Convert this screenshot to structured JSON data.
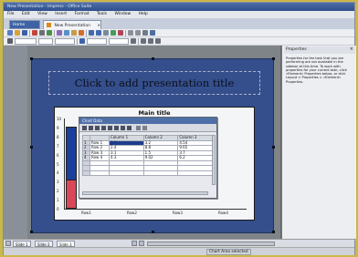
{
  "window": {
    "title": "New Presentation - Impress - Office Suite"
  },
  "menu": [
    "File",
    "Edit",
    "View",
    "Insert",
    "Format",
    "Tools",
    "Window",
    "Help"
  ],
  "tabs": {
    "home_label": "Home",
    "doc_label": "New Presentation",
    "doc_close": "×"
  },
  "slide": {
    "title_placeholder": "Click to add presentation title"
  },
  "chart": {
    "title": "Main title",
    "y_ticks": [
      "10",
      "9",
      "8",
      "7",
      "6",
      "5",
      "4",
      "3",
      "2",
      "1",
      "0"
    ]
  },
  "datasheet": {
    "title": "Chart Data",
    "columns": [
      "",
      "",
      "Column 1",
      "Column 2",
      "Column 3"
    ],
    "rows": [
      [
        "1",
        "Row 1",
        "9.1",
        "3.2",
        "4.54"
      ],
      [
        "2",
        "Row 2",
        "2.4",
        "8.8",
        "9.65"
      ],
      [
        "3",
        "Row 3",
        "3.1",
        "1.5",
        "3.7"
      ],
      [
        "4",
        "Row 4",
        "4.3",
        "9.02",
        "6.2"
      ]
    ]
  },
  "panel": {
    "title": "Properties",
    "close": "×",
    "text": "Properties for the task that you are performing are not available in the sidebar at this time. To work with properties for your current task, click «Element» Properties below, or click Layout > Properties > «Element» Properties."
  },
  "sheet_tabs": [
    "Slide 1",
    "Slide 2",
    "Slide 3"
  ],
  "status": {
    "text": "Chart Area selected"
  },
  "chart_data": {
    "type": "bar",
    "title": "Main title",
    "categories": [
      "Row1",
      "Row2",
      "Row3",
      "Row4"
    ],
    "ylim": [
      0,
      10
    ],
    "series": [
      {
        "name": "Column 1",
        "values": [
          9.1,
          2.4,
          3.1,
          4.3
        ]
      },
      {
        "name": "Column 2",
        "values": [
          3.2,
          8.8,
          1.5,
          9.02
        ]
      },
      {
        "name": "Column 3",
        "values": [
          4.54,
          9.65,
          3.7,
          6.2
        ]
      }
    ],
    "colors": [
      "#1d3f9c",
      "#d8485a",
      "#f0c64a"
    ],
    "legend": "none",
    "grid": false
  }
}
